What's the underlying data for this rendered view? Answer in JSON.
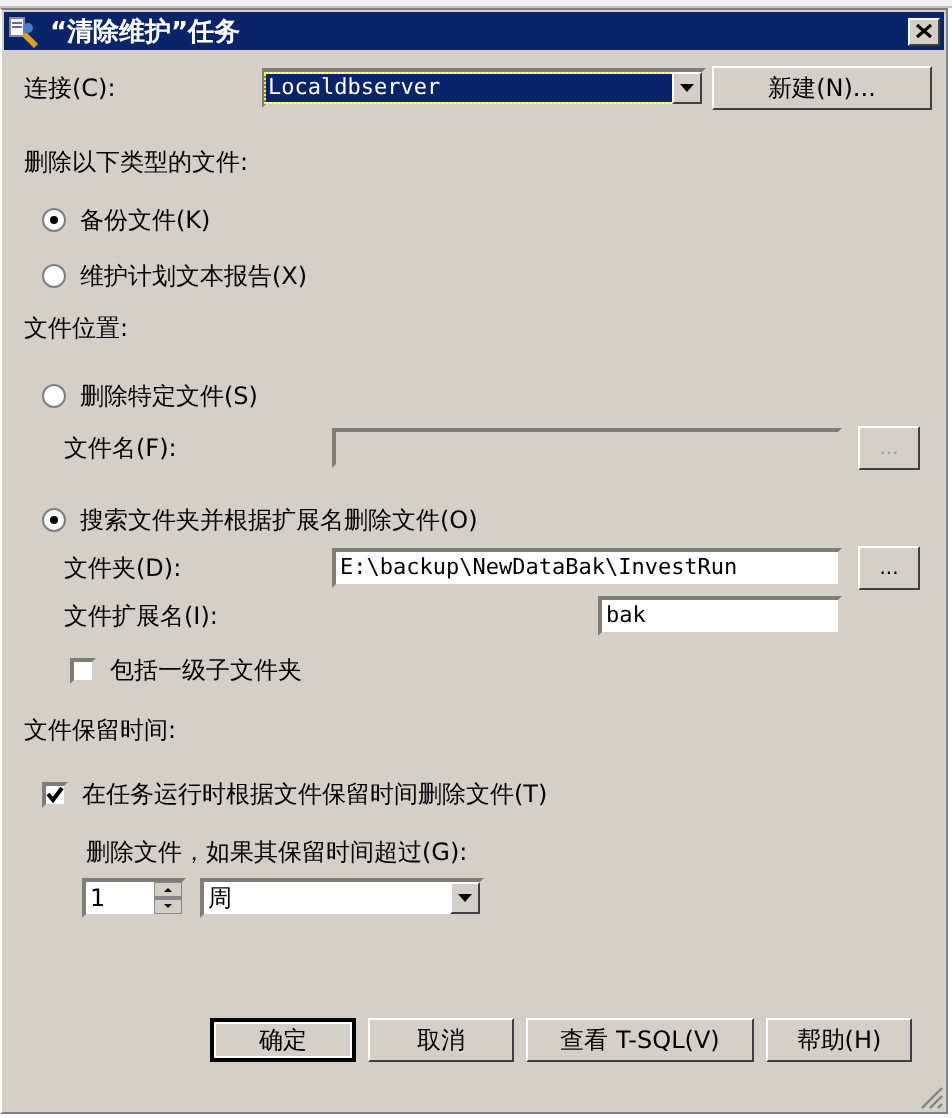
{
  "window": {
    "title": "“清除维护”任务"
  },
  "connection": {
    "label": "连接(C):",
    "value": "Localdbserver",
    "new_button": "新建(N)..."
  },
  "file_type": {
    "heading": "删除以下类型的文件:",
    "options": [
      {
        "label": "备份文件(K)",
        "selected": true
      },
      {
        "label": "维护计划文本报告(X)",
        "selected": false
      }
    ]
  },
  "file_location": {
    "heading": "文件位置:",
    "options": [
      {
        "label": "删除特定文件(S)",
        "selected": false
      },
      {
        "label": "搜索文件夹并根据扩展名删除文件(O)",
        "selected": true
      }
    ],
    "file_name": {
      "label": "文件名(F):",
      "disabled": true,
      "browse": "..."
    },
    "folder": {
      "label": "文件夹(D):",
      "value": "E:\\backup\\NewDataBak\\InvestRun",
      "browse": "..."
    },
    "extension": {
      "label": "文件扩展名(I):",
      "value": "bak"
    },
    "include_subfolders": {
      "label": "包括一级子文件夹",
      "checked": false
    }
  },
  "retention": {
    "heading": "文件保留时间:",
    "delete_by_age": {
      "label": "在任务运行时根据文件保留时间删除文件(T)",
      "checked": true
    },
    "age_label": "删除文件，如果其保留时间超过(G):",
    "amount": "1",
    "unit": "周"
  },
  "buttons": [
    {
      "label": "确定",
      "default": true
    },
    {
      "label": "取消",
      "default": false
    },
    {
      "label": "查看 T-SQL(V)",
      "default": false
    },
    {
      "label": "帮助(H)",
      "default": false
    }
  ]
}
